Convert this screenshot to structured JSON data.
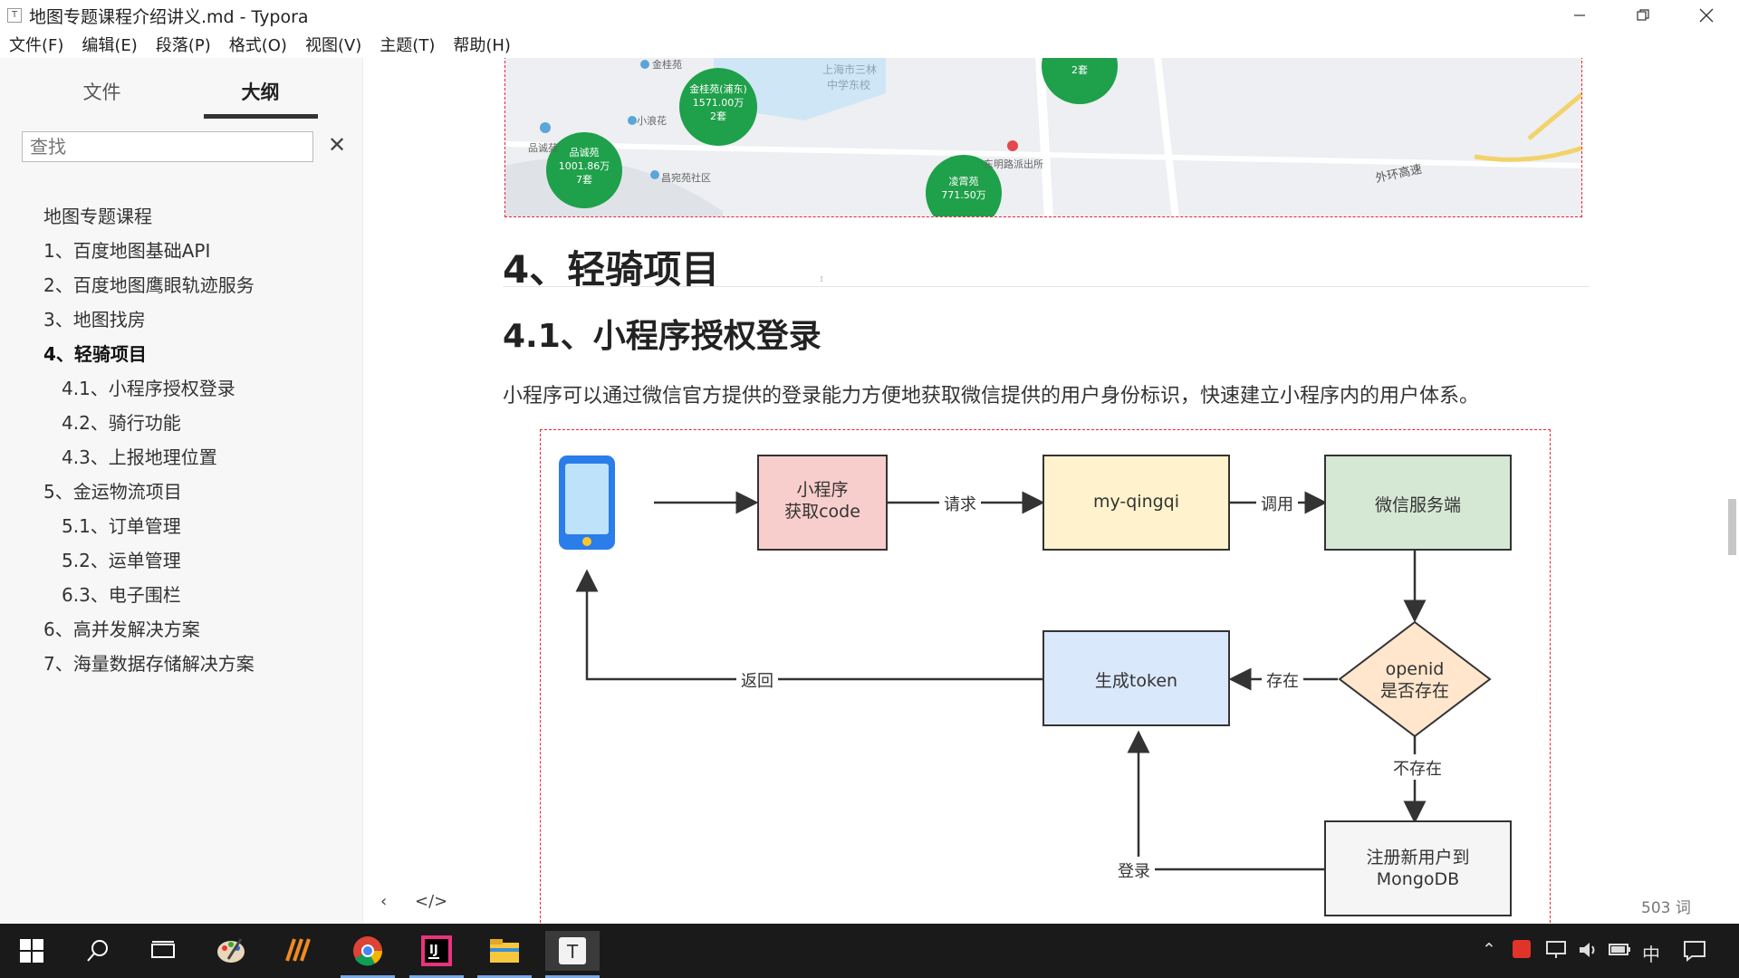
{
  "window": {
    "title": "地图专题课程介绍讲义.md - Typora",
    "icon_letter": "T"
  },
  "menu": [
    "文件(F)",
    "编辑(E)",
    "段落(P)",
    "格式(O)",
    "视图(V)",
    "主题(T)",
    "帮助(H)"
  ],
  "sidebar": {
    "tabs": {
      "files": "文件",
      "outline": "大纲"
    },
    "search_placeholder": "查找",
    "outline": [
      {
        "label": "地图专题课程",
        "level": 1
      },
      {
        "label": "1、百度地图基础API",
        "level": 1
      },
      {
        "label": "2、百度地图鹰眼轨迹服务",
        "level": 1
      },
      {
        "label": "3、地图找房",
        "level": 1
      },
      {
        "label": "4、轻骑项目",
        "level": 1,
        "active": true
      },
      {
        "label": "4.1、小程序授权登录",
        "level": 2
      },
      {
        "label": "4.2、骑行功能",
        "level": 2
      },
      {
        "label": "4.3、上报地理位置",
        "level": 2
      },
      {
        "label": "5、金运物流项目",
        "level": 1
      },
      {
        "label": "5.1、订单管理",
        "level": 2
      },
      {
        "label": "5.2、运单管理",
        "level": 2
      },
      {
        "label": "6.3、电子围栏",
        "level": 2
      },
      {
        "label": "6、高并发解决方案",
        "level": 1
      },
      {
        "label": "7、海量数据存储解决方案",
        "level": 1
      }
    ],
    "footer": {
      "back": "‹",
      "code": "</>"
    }
  },
  "map": {
    "labels": [
      "上海市三林",
      "中学东校",
      "东明路派出所",
      "外环高速",
      "小浪花",
      "品诚苑",
      "昌宛苑社区",
      "金桂苑"
    ],
    "clusters": [
      {
        "name": "金桂苑(浦东)",
        "price": "1571.00万",
        "count": "2套"
      },
      {
        "name": "品诚苑",
        "price": "1001.86万",
        "count": "7套"
      },
      {
        "name": "凌霄苑",
        "price": "771.50万",
        "count": ""
      },
      {
        "name": "",
        "price": "",
        "count": "2套"
      }
    ]
  },
  "doc": {
    "h1": "4、轻骑项目",
    "h2": "4.1、小程序授权登录",
    "para": "小程序可以通过微信官方提供的登录能力方便地获取微信提供的用户身份标识，快速建立小程序内的用户体系。"
  },
  "diagram": {
    "box_miniprogram": [
      "小程序",
      "获取code"
    ],
    "box_server": "my-qingqi",
    "box_wechat": "微信服务端",
    "diamond": [
      "openid",
      "是否存在"
    ],
    "box_token": "生成token",
    "box_register": [
      "注册新用户到",
      "MongoDB"
    ],
    "edge_request": "请求",
    "edge_call": "调用",
    "edge_exists": "存在",
    "edge_not_exists": "不存在",
    "edge_login": "登录",
    "edge_return": "返回",
    "colors": {
      "pink": "#f8cecc",
      "yellow": "#fff2cc",
      "green": "#d5e8d4",
      "blue": "#dae8fc",
      "orange": "#ffe6cc",
      "gray": "#f5f5f5"
    }
  },
  "status": {
    "word_count": "503 词"
  },
  "taskbar": {
    "icons": [
      "windows-start-icon",
      "search-icon",
      "task-view-icon",
      "paint-icon",
      "sublime-icon",
      "chrome-icon",
      "intellij-icon",
      "file-explorer-icon",
      "typora-icon"
    ],
    "tray": {
      "ime": "中"
    }
  }
}
